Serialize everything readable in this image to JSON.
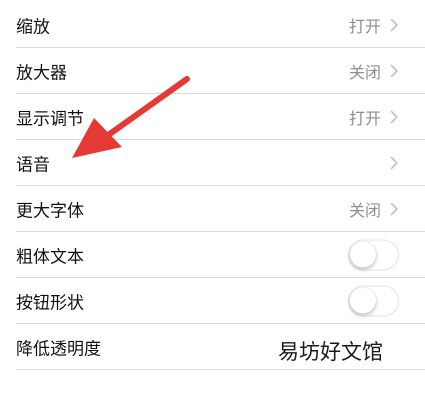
{
  "settings": {
    "rows": [
      {
        "label": "缩放",
        "value": "打开"
      },
      {
        "label": "放大器",
        "value": "关闭"
      },
      {
        "label": "显示调节",
        "value": "打开"
      },
      {
        "label": "语音",
        "value": ""
      },
      {
        "label": "更大字体",
        "value": "关闭"
      },
      {
        "label": "粗体文本",
        "toggle_on": false
      },
      {
        "label": "按钮形状",
        "toggle_on": false
      },
      {
        "label": "降低透明度"
      }
    ]
  },
  "annotation": {
    "arrow_color": "#e53935"
  },
  "watermark": {
    "text": "易坊好文馆"
  },
  "colors": {
    "value_gray": "#8e8e93",
    "separator": "#dcdce0"
  }
}
